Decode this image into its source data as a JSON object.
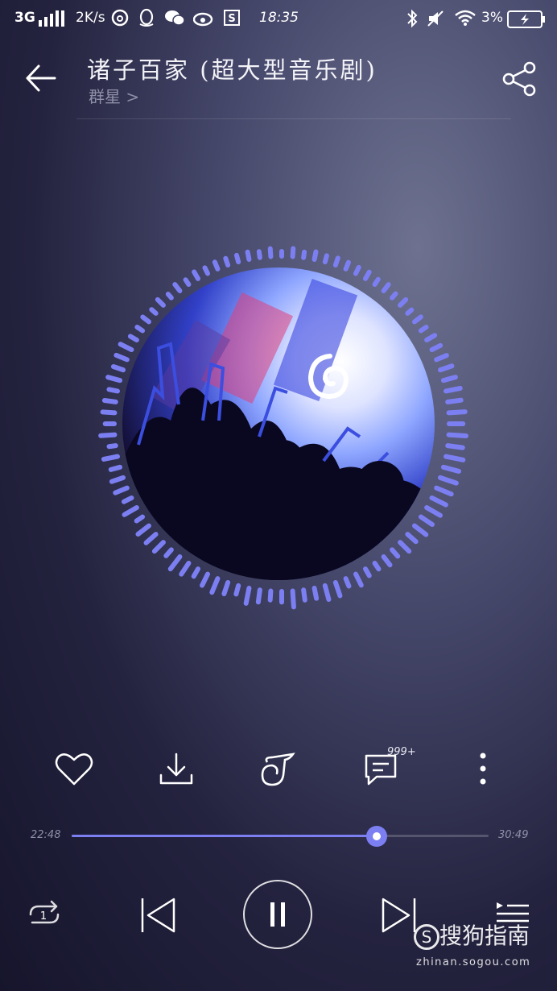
{
  "status_bar": {
    "network": "3G",
    "speed": "2K/s",
    "time": "18:35",
    "battery": "3%",
    "icons": [
      "signal-icon",
      "netease-music-icon",
      "qq-icon",
      "wechat-icon",
      "weibo-icon",
      "s-app-icon",
      "bluetooth-icon",
      "mute-icon",
      "wifi-icon",
      "battery-icon"
    ]
  },
  "header": {
    "title": "诸子百家 (超大型音乐剧)",
    "artist": "群星 >"
  },
  "player": {
    "current_time": "22:48",
    "total_time": "30:49",
    "progress": 0.732,
    "comment_count": "999+",
    "accent_color": "#7c7ff2"
  },
  "actions": [
    "heart-icon",
    "download-icon",
    "music-note-icon",
    "comment-icon",
    "more-icon"
  ],
  "controls": [
    "repeat-one-icon",
    "previous-icon",
    "pause-icon",
    "next-icon",
    "playlist-icon"
  ],
  "watermark": {
    "logo": "搜狗指南",
    "url": "zhinan.sogou.com"
  }
}
